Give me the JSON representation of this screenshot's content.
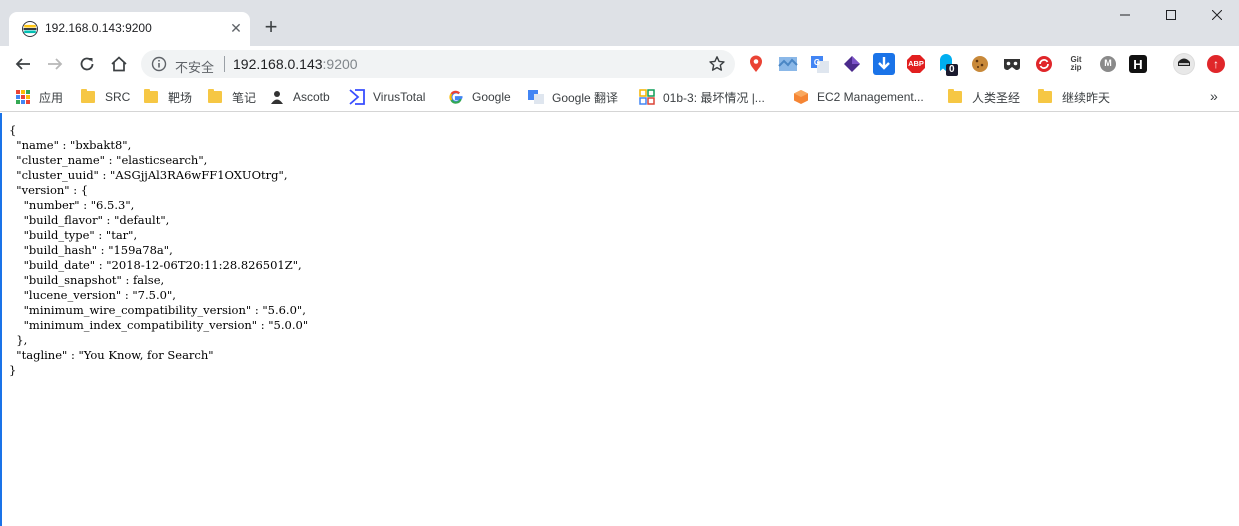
{
  "tab": {
    "title": "192.168.0.143:9200",
    "close_glyph": "✕",
    "favicon": "elasticsearch-icon"
  },
  "new_tab_glyph": "+",
  "omnibox": {
    "security_label": "不安全",
    "url_host": "192.168.0.143",
    "url_port": ":9200"
  },
  "bookmarks": [
    {
      "label": "应用",
      "icon": "apps-grid-icon"
    },
    {
      "label": "SRC",
      "icon": "folder-icon"
    },
    {
      "label": "靶场",
      "icon": "folder-icon"
    },
    {
      "label": "笔记",
      "icon": "folder-icon"
    },
    {
      "label": "Ascotb",
      "icon": "person-icon"
    },
    {
      "label": "VirusTotal",
      "icon": "virustotal-icon"
    },
    {
      "label": "Google",
      "icon": "google-icon"
    },
    {
      "label": "Google 翻译",
      "icon": "translate-icon"
    },
    {
      "label": "01b-3: 最坏情况 |...",
      "icon": "grid-icon"
    },
    {
      "label": "EC2 Management...",
      "icon": "aws-icon"
    },
    {
      "label": "人类圣经",
      "icon": "folder-icon"
    },
    {
      "label": "继续昨天",
      "icon": "folder-icon"
    }
  ],
  "bookmarks_overflow": "»",
  "extensions": [
    {
      "name": "location-pin-icon",
      "text": "",
      "color": "#ea4335"
    },
    {
      "name": "map-ext-icon",
      "text": "",
      "color": "#4a86c5"
    },
    {
      "name": "translate-ext-icon",
      "text": "",
      "color": "#4285f4"
    },
    {
      "name": "cube-ext-icon",
      "text": "",
      "color": "#4b2a8c"
    },
    {
      "name": "download-ext-icon",
      "text": "",
      "color": "#1a73e8"
    },
    {
      "name": "adblock-plus-icon",
      "text": "ABP",
      "color": "#e21f1f"
    },
    {
      "name": "ghostery-icon",
      "text": "0",
      "color": "#00aef0"
    },
    {
      "name": "cookie-icon",
      "text": "",
      "color": "#c8893a"
    },
    {
      "name": "mask-ext-icon",
      "text": "",
      "color": "#333333"
    },
    {
      "name": "refresh-red-icon",
      "text": "",
      "color": "#e0262a"
    },
    {
      "name": "gitzip-icon",
      "text": "Git zip",
      "color": "#444444"
    },
    {
      "name": "metamask-ext-icon",
      "text": "M",
      "color": "#8a8a8a"
    },
    {
      "name": "h-ext-icon",
      "text": "H",
      "color": "#111111"
    },
    {
      "name": "profile-avatar-icon",
      "text": "",
      "color": "#222222"
    },
    {
      "name": "update-icon",
      "text": "↑",
      "color": "#e0262a"
    }
  ],
  "json_lines": [
    "{",
    "  \"name\" : \"bxbakt8\",",
    "  \"cluster_name\" : \"elasticsearch\",",
    "  \"cluster_uuid\" : \"ASGjjAl3RA6wFF1OXUOtrg\",",
    "  \"version\" : {",
    "    \"number\" : \"6.5.3\",",
    "    \"build_flavor\" : \"default\",",
    "    \"build_type\" : \"tar\",",
    "    \"build_hash\" : \"159a78a\",",
    "    \"build_date\" : \"2018-12-06T20:11:28.826501Z\",",
    "    \"build_snapshot\" : false,",
    "    \"lucene_version\" : \"7.5.0\",",
    "    \"minimum_wire_compatibility_version\" : \"5.6.0\",",
    "    \"minimum_index_compatibility_version\" : \"5.0.0\"",
    "  },",
    "  \"tagline\" : \"You Know, for Search\"",
    "}"
  ]
}
